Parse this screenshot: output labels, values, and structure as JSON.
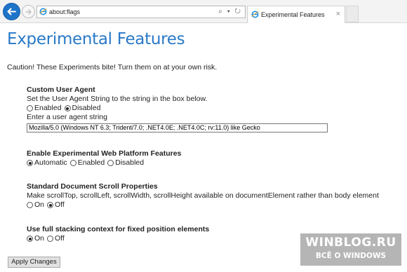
{
  "browser": {
    "address": "about:flags",
    "address_tools": "⌕ ▾ ↻",
    "tab_title": "Experimental Features",
    "tab_close": "×"
  },
  "page": {
    "title": "Experimental Features",
    "warning": "Caution! These Experiments bite! Turn them on at your own risk."
  },
  "sections": {
    "user_agent": {
      "title": "Custom User Agent",
      "description": "Set the User Agent String to the string in the box below.",
      "options": [
        "Enabled",
        "Disabled"
      ],
      "selected": "Disabled",
      "input_label": "Enter a user agent string",
      "input_value": "Mozilla/5.0 (Windows NT 6.3; Trident/7.0; .NET4.0E; .NET4.0C; rv:11.0) like Gecko"
    },
    "web_platform": {
      "title": "Enable Experimental Web Platform Features",
      "options": [
        "Automatic",
        "Enabled",
        "Disabled"
      ],
      "selected": "Automatic"
    },
    "scroll": {
      "title": "Standard Document Scroll Properties",
      "description": "Make scrollTop, scrollLeft, scrollWidth, scrollHeight available on documentElement rather than body element",
      "options": [
        "On",
        "Off"
      ],
      "selected": "Off"
    },
    "stacking": {
      "title": "Use full stacking context for fixed position elements",
      "options": [
        "On",
        "Off"
      ],
      "selected": "On"
    }
  },
  "apply_button": "Apply Changes",
  "watermark": {
    "line1": "WINBLOG.RU",
    "line2": "ВСЁ О WINDOWS"
  },
  "icons": {
    "back": "back-arrow-icon",
    "forward": "forward-arrow-icon",
    "page": "ie-page-icon"
  },
  "colors": {
    "accent": "#2979c8",
    "back_button": "#1e74c8"
  }
}
